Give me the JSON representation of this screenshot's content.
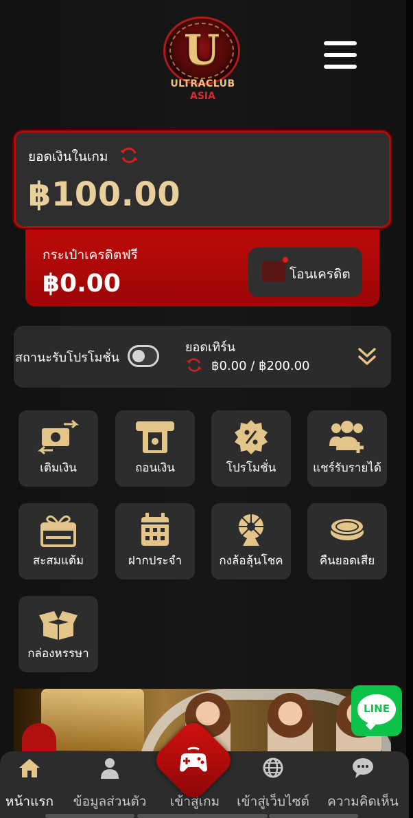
{
  "header": {
    "logo_text": "ULTRACLUB",
    "logo_sub": "ASIA",
    "logo_letter": "U"
  },
  "wallet": {
    "game_balance_label": "ยอดเงินในเกม",
    "game_balance": "฿100.00",
    "free_credit_label": "กระเป๋าเครดิตฟรี",
    "free_credit": "฿0.00",
    "transfer_label": "โอนเครดิต"
  },
  "promo": {
    "status_label": "สถานะรับโปรโมชั่น",
    "toggle_on": false,
    "turnover_label": "ยอดเทิร์น",
    "turnover_value": "฿0.00 / ฿200.00"
  },
  "menu": {
    "items": [
      {
        "label": "เติมเงิน",
        "icon": "deposit-icon"
      },
      {
        "label": "ถอนเงิน",
        "icon": "withdraw-icon"
      },
      {
        "label": "โปรโมชั่น",
        "icon": "promotion-icon"
      },
      {
        "label": "แชร์รับรายได้",
        "icon": "share-earn-icon"
      },
      {
        "label": "สะสมแต้ม",
        "icon": "gift-points-icon"
      },
      {
        "label": "ฝากประจำ",
        "icon": "calendar-icon"
      },
      {
        "label": "กงล้อลุ้นโชค",
        "icon": "wheel-icon"
      },
      {
        "label": "คืนยอดเสีย",
        "icon": "coin-cashback-icon"
      },
      {
        "label": "กล่องหรรษา",
        "icon": "mystery-box-icon"
      }
    ]
  },
  "line": {
    "label": "LINE"
  },
  "nav": {
    "items": [
      {
        "label": "หน้าแรก",
        "icon": "home-icon"
      },
      {
        "label": "ข้อมูลส่วนตัว",
        "icon": "user-icon"
      },
      {
        "label": "เข้าสู่เกม",
        "icon": "gamepad-icon"
      },
      {
        "label": "เข้าสู่เว็บไซต์",
        "icon": "globe-icon"
      },
      {
        "label": "ความคิดเห็น",
        "icon": "chat-icon"
      }
    ]
  },
  "colors": {
    "accent_red": "#b00c0c",
    "gold": "#e8cf9c",
    "card_bg": "#2d2d2d",
    "line_green": "#0ec149"
  }
}
